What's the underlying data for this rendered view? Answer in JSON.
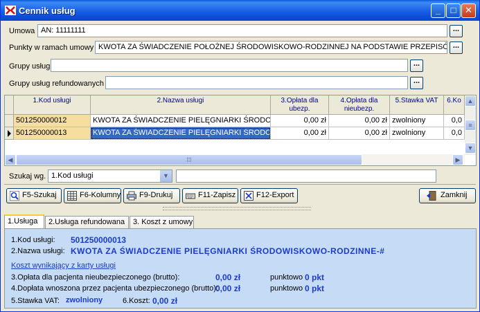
{
  "window": {
    "title": "Cennik usług"
  },
  "form": {
    "umowa_label": "Umowa",
    "umowa_value": "AN: 11111111",
    "punkty_label": "Punkty w ramach umowy",
    "punkty_value": "KWOTA ZA ŚWIADCZENIE POŁOŻNEJ ŚRODOWISKOWO-RODZINNEJ NA PODSTAWIE PRZEPISÓW",
    "grupy_label": "Grupy usług",
    "grupy_value": "",
    "grupy_ref_label": "Grupy usług refundowanych",
    "grupy_ref_value": "",
    "dots": "..."
  },
  "grid": {
    "headers": [
      "1.Kod usługi",
      "2.Nazwa usługi",
      "3.Opłata dla ubezp.",
      "4.Opłata dla nieubezp.",
      "5.Stawka VAT",
      "6.Ko"
    ],
    "rows": [
      {
        "kod": "501250000012",
        "nazwa": "KWOTA ZA ŚWIADCZENIE PIELĘGNIARKI ŚRODOWISKOWO",
        "op_ubezp": "0,00 zł",
        "op_nieubezp": "0,00 zł",
        "vat": "zwolniony",
        "koszt": "0,0"
      },
      {
        "kod": "501250000013",
        "nazwa": "KWOTA ZA ŚWIADCZENIE PIELĘGNIARKI ŚRODOWISKOWO",
        "op_ubezp": "0,00 zł",
        "op_nieubezp": "0,00 zł",
        "vat": "zwolniony",
        "koszt": "0,0"
      }
    ]
  },
  "search": {
    "label": "Szukaj wg.",
    "selected": "1.Kod usługi",
    "value": ""
  },
  "toolbar": {
    "szukaj": "F5-Szukaj",
    "kolumny": "F6-Kolumny",
    "drukuj": "F9-Drukuj",
    "zapisz": "F11-Zapisz",
    "export": "F12-Export",
    "zamknij": "Zamknij"
  },
  "tabs": [
    "1.Usługa",
    "2.Usługa refundowana",
    "3. Koszt z umowy"
  ],
  "details": {
    "kod_label": "1.Kod usługi:",
    "kod_value": "501250000013",
    "nazwa_label": "2.Nazwa usługi:",
    "nazwa_value": "KWOTA ZA ŚWIADCZENIE PIELĘGNIARKI ŚRODOWISKOWO-RODZINNE-#",
    "koszt_heading": "Koszt wynikający z karty usługi",
    "op3_label": "3.Opłata dla pacjenta nieubezpieczonego (brutto):",
    "op3_value": "0,00 zł",
    "op3_pkt_label": "punktowo",
    "op3_pkt_value": "0 pkt",
    "op4_label": "4.Dopłata wnoszona przez pacjenta ubezpieczonego (brutto):",
    "op4_value": "0,00 zł",
    "op4_pkt_label": "punktowo",
    "op4_pkt_value": "0 pkt",
    "vat_label": "5.Stawka VAT:",
    "vat_value": "zwolniony",
    "koszt_label": "6.Koszt:",
    "koszt_value": "0,00 zł"
  },
  "colors": {
    "title_bar": "#0a5bdc",
    "selected_row": "#316ac5",
    "key_cell": "#f5dea0",
    "panel": "#c6dbf5",
    "value_text": "#1a3ccc"
  }
}
